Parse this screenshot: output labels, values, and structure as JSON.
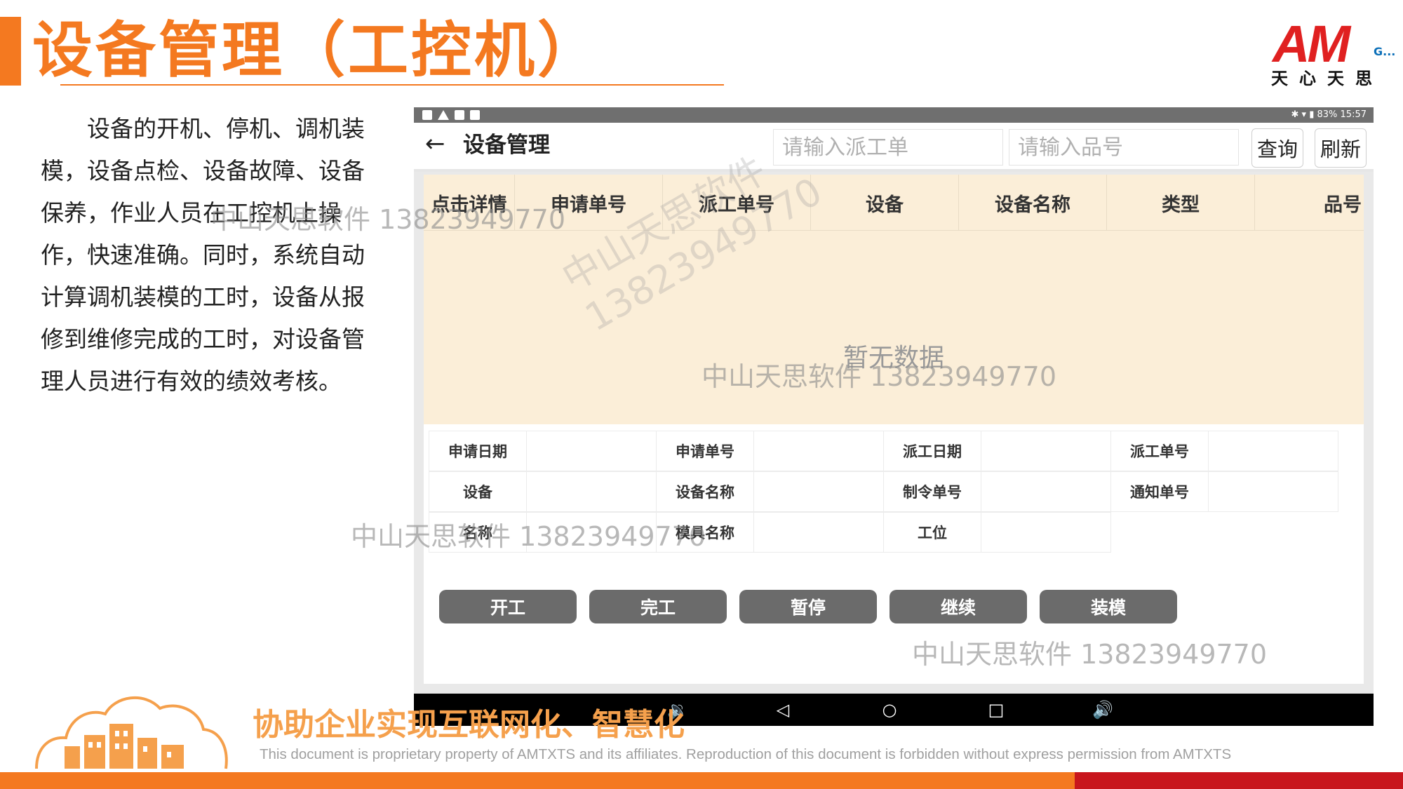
{
  "slide": {
    "title": "设备管理（工控机）",
    "description": "设备的开机、停机、调机装模，设备点检、设备故障、设备保养，作业人员在工控机上操作，快速准确。同时，系统自动计算调机装模的工时，设备从报修到维修完成的工时，对设备管理人员进行有效的绩效考核。"
  },
  "logo": {
    "letters": "AM",
    "suffix": "G...",
    "chinese": "天心天思"
  },
  "status_bar": {
    "right": "✱ ▾ ▮ 83%  15:57"
  },
  "app": {
    "title": "设备管理",
    "search": {
      "order_placeholder": "请输入派工单",
      "item_placeholder": "请输入品号"
    },
    "buttons": {
      "query": "查询",
      "refresh": "刷新"
    },
    "table": {
      "columns": [
        "点击详情",
        "申请单号",
        "派工单号",
        "设备",
        "设备名称",
        "类型",
        "品号"
      ],
      "empty_text": "暂无数据"
    },
    "details": [
      [
        "申请日期",
        "申请单号",
        "派工日期",
        "派工单号"
      ],
      [
        "设备",
        "设备名称",
        "制令单号",
        "通知单号"
      ],
      [
        "名称",
        "模具名称",
        "工位"
      ]
    ],
    "actions": [
      "开工",
      "完工",
      "暂停",
      "继续",
      "装模"
    ]
  },
  "watermarks": {
    "text": "中山天思软件 13823949770",
    "diag_line1": "中山天思软件",
    "diag_line2": "13823949770"
  },
  "footer": {
    "slogan": "协助企业实现互联网化、智慧化",
    "disclaimer": "This document is proprietary property of AMTXTS and its affiliates. Reproduction of this document is forbidden without express permission from AMTXTS"
  },
  "colors": {
    "brand_orange": "#f47920",
    "brand_red": "#c8161d",
    "table_bg": "#fbeed8",
    "button_gray": "#6b6b6b"
  }
}
